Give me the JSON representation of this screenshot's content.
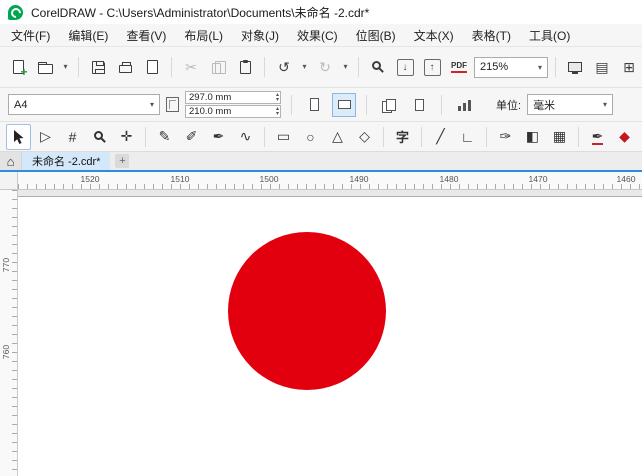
{
  "window": {
    "title": "CorelDRAW - C:\\Users\\Administrator\\Documents\\未命名 -2.cdr*"
  },
  "menu": {
    "items": [
      "文件(F)",
      "编辑(E)",
      "查看(V)",
      "布局(L)",
      "对象(J)",
      "效果(C)",
      "位图(B)",
      "文本(X)",
      "表格(T)",
      "工具(O)"
    ]
  },
  "standard_toolbar": {
    "zoom_level": "215%",
    "pdf_label": "PDF"
  },
  "property_bar": {
    "page_size": "A4",
    "page_width": "297.0 mm",
    "page_height": "210.0 mm",
    "units_label": "单位:",
    "units_value": "毫米"
  },
  "document_tabs": {
    "active_label": "未命名 -2.cdr*",
    "add_label": "+"
  },
  "rulers": {
    "horizontal": [
      "1520",
      "1510",
      "1500",
      "1490",
      "1480",
      "1470",
      "1460"
    ],
    "vertical": [
      "770",
      "760"
    ]
  },
  "canvas": {
    "circle_color": "#e3000e"
  },
  "colors": {
    "accent_blue": "#2f8be0",
    "logo_green": "#00a651",
    "circle_red": "#e3000e"
  },
  "icons": {
    "caret": "▾",
    "cut": "✂",
    "undo": "↺",
    "redo": "↻",
    "import_arrow": "↓",
    "export_arrow": "↑",
    "shape_tool": "▷",
    "crop": "#",
    "pan": "✛",
    "freehand": "✎",
    "artistic_media": "✐",
    "pen": "✒",
    "bezier": "∿",
    "rectangle": "▭",
    "ellipse": "○",
    "polygon": "△",
    "common_shapes": "◇",
    "text_tool": "字",
    "dimension": "╱",
    "connector": "∟",
    "eyedropper": "✑",
    "interactive_fill": "◧",
    "mesh_fill": "▦",
    "outline_pen": "✒",
    "fill": "◆",
    "transparency": "▨",
    "rulers_toggle": "▤",
    "grid_toggle": "⊞",
    "home": "⌂",
    "spin_up": "▴",
    "spin_down": "▾"
  }
}
